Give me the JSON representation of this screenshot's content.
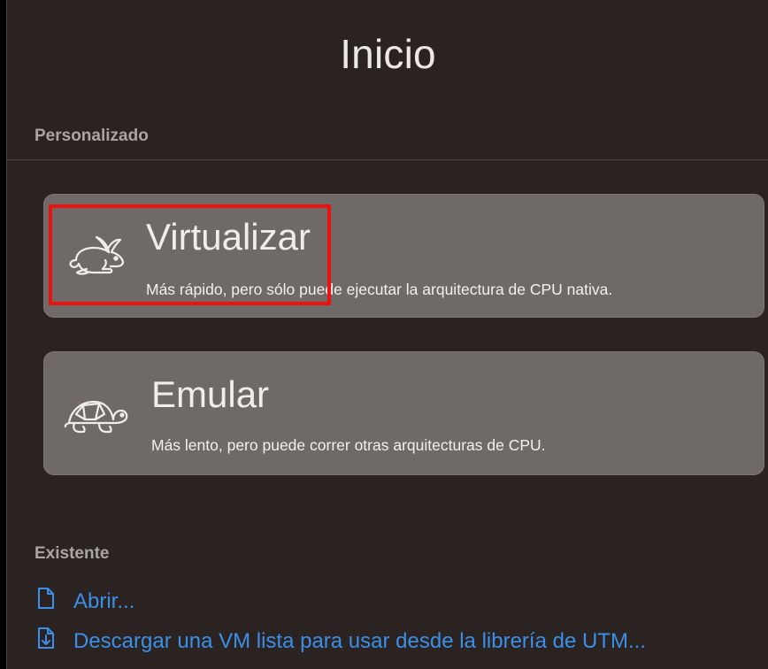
{
  "header": {
    "title": "Inicio"
  },
  "sections": {
    "custom_label": "Personalizado",
    "existing_label": "Existente"
  },
  "options": {
    "virtualize": {
      "icon": "rabbit-icon",
      "title": "Virtualizar",
      "description": "Más rápido, pero sólo puede ejecutar la arquitectura de CPU nativa."
    },
    "emulate": {
      "icon": "turtle-icon",
      "title": "Emular",
      "description": "Más lento, pero puede correr otras arquitecturas de CPU."
    }
  },
  "links": {
    "open": {
      "icon": "document-icon",
      "label": "Abrir..."
    },
    "download": {
      "icon": "document-download-icon",
      "label": "Descargar una VM lista para usar desde la librería de UTM..."
    }
  },
  "colors": {
    "background": "#2a2321",
    "card": "#6f6a68",
    "link": "#3c8fe8",
    "highlight": "#ee1111"
  }
}
